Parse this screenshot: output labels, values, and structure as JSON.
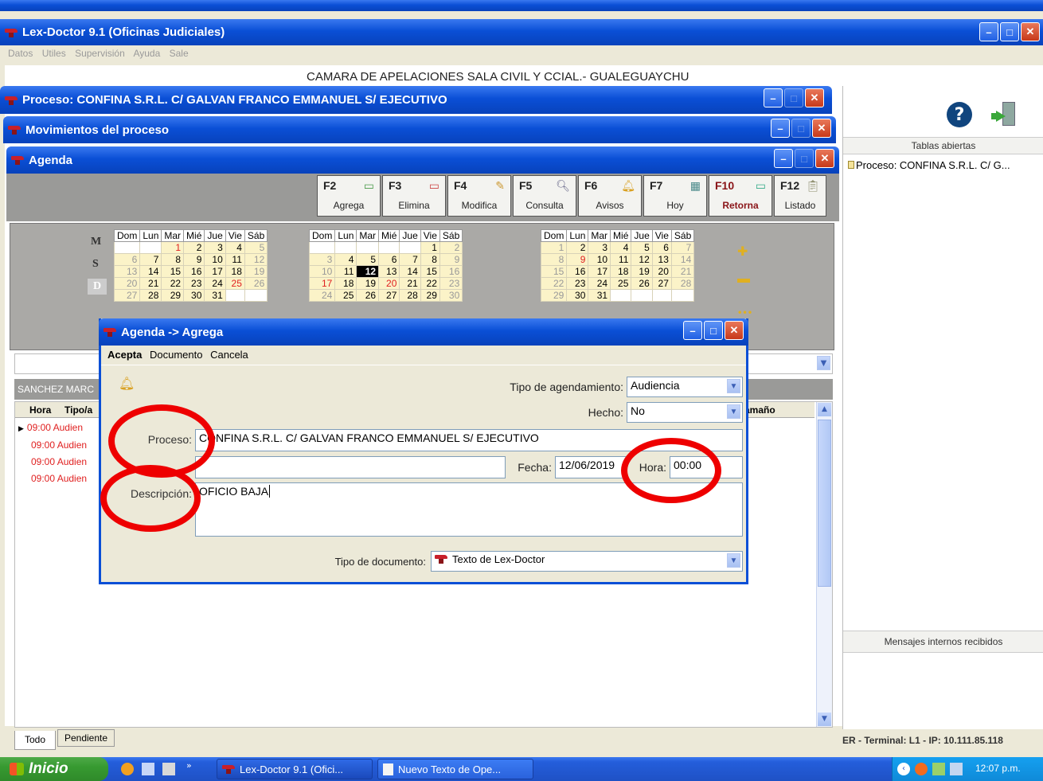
{
  "app": {
    "title": "Lex-Doctor 9.1 (Oficinas Judiciales)",
    "menu": [
      "Datos",
      "Utiles",
      "Supervisión",
      "Ayuda",
      "Sale"
    ],
    "org_header": "CAMARA DE APELACIONES SALA CIVIL Y CCIAL.- GUALEGUAYCHU"
  },
  "windows": {
    "proceso_title": "Proceso: CONFINA S.R.L. C/ GALVAN FRANCO EMMANUEL S/ EJECUTIVO",
    "movimientos_title": "Movimientos del proceso",
    "agenda_title": "Agenda"
  },
  "toolbar": [
    {
      "key": "F2",
      "label": "Agrega",
      "icon": "add-doc-icon"
    },
    {
      "key": "F3",
      "label": "Elimina",
      "icon": "delete-doc-icon"
    },
    {
      "key": "F4",
      "label": "Modifica",
      "icon": "edit-icon"
    },
    {
      "key": "F5",
      "label": "Consulta",
      "icon": "search-icon"
    },
    {
      "key": "F6",
      "label": "Avisos",
      "icon": "bell-icon"
    },
    {
      "key": "F7",
      "label": "Hoy",
      "icon": "calendar-icon"
    },
    {
      "key": "F10",
      "label": "Retorna",
      "icon": "return-icon"
    },
    {
      "key": "F12",
      "label": "Listado",
      "icon": "clipboard-icon"
    }
  ],
  "view_modes": {
    "m": "M",
    "s": "S",
    "d": "D"
  },
  "calendar": {
    "weekdays": [
      "Dom",
      "Lun",
      "Mar",
      "Mié",
      "Jue",
      "Vie",
      "Sáb"
    ],
    "months": [
      {
        "weeks": [
          [
            "",
            "",
            "1",
            "2",
            "3",
            "4",
            "5"
          ],
          [
            "6",
            "7",
            "8",
            "9",
            "10",
            "11",
            "12"
          ],
          [
            "13",
            "14",
            "15",
            "16",
            "17",
            "18",
            "19"
          ],
          [
            "20",
            "21",
            "22",
            "23",
            "24",
            "25",
            "26"
          ],
          [
            "27",
            "28",
            "29",
            "30",
            "31",
            "",
            ""
          ]
        ]
      },
      {
        "weeks": [
          [
            "",
            "",
            "",
            "",
            "",
            "1",
            "2"
          ],
          [
            "3",
            "4",
            "5",
            "6",
            "7",
            "8",
            "9"
          ],
          [
            "10",
            "11",
            "12",
            "13",
            "14",
            "15",
            "16"
          ],
          [
            "17",
            "18",
            "19",
            "20",
            "21",
            "22",
            "23"
          ],
          [
            "24",
            "25",
            "26",
            "27",
            "28",
            "29",
            "30"
          ]
        ]
      },
      {
        "weeks": [
          [
            "1",
            "2",
            "3",
            "4",
            "5",
            "6",
            "7"
          ],
          [
            "8",
            "9",
            "10",
            "11",
            "12",
            "13",
            "14"
          ],
          [
            "15",
            "16",
            "17",
            "18",
            "19",
            "20",
            "21"
          ],
          [
            "22",
            "23",
            "24",
            "25",
            "26",
            "27",
            "28"
          ],
          [
            "29",
            "30",
            "31",
            "",
            "",
            "",
            ""
          ]
        ]
      }
    ]
  },
  "list": {
    "owner": "SANCHEZ MARC",
    "columns": [
      "Hora",
      "Tipo/a",
      "amaño"
    ],
    "rows": [
      {
        "hora": "09:00",
        "tipo": "Audien"
      },
      {
        "hora": "09:00",
        "tipo": "Audien"
      },
      {
        "hora": "09:00",
        "tipo": "Audien"
      },
      {
        "hora": "09:00",
        "tipo": "Audien"
      }
    ]
  },
  "bottom_tabs": [
    "Todo",
    "Pendiente"
  ],
  "right_panel": {
    "tablas_header": "Tablas abiertas",
    "tablas_item": "Proceso: CONFINA S.R.L. C/ G...",
    "mensajes_header": "Mensajes internos recibidos",
    "status": "ER - Terminal: L1 - IP: 10.111.85.118"
  },
  "dialog": {
    "title": "Agenda -> Agrega",
    "menu": [
      "Acepta",
      "Documento",
      "Cancela"
    ],
    "tipo_agend_label": "Tipo de agendamiento:",
    "tipo_agend_value": "Audiencia",
    "hecho_label": "Hecho:",
    "hecho_value": "No",
    "proceso_label": "Proceso:",
    "proceso_value": "CONFINA S.R.L. C/ GALVAN FRANCO EMMANUEL S/ EJECUTIVO",
    "fecha_label": "Fecha:",
    "fecha_value": "12/06/2019",
    "hora_label": "Hora:",
    "hora_value": "00:00",
    "descripcion_label": "Descripción:",
    "descripcion_value": "OFICIO BAJA",
    "tipo_doc_label": "Tipo de documento:",
    "tipo_doc_value": "Texto de Lex-Doctor"
  },
  "taskbar": {
    "start": "Inicio",
    "items": [
      "Lex-Doctor 9.1 (Ofici...",
      "Nuevo Texto de Ope..."
    ],
    "clock": "12:07 p.m."
  },
  "colors": {
    "accent": "#0a4fd6",
    "alert": "#ee0000",
    "calendar_bg": "#fbf3c8"
  }
}
